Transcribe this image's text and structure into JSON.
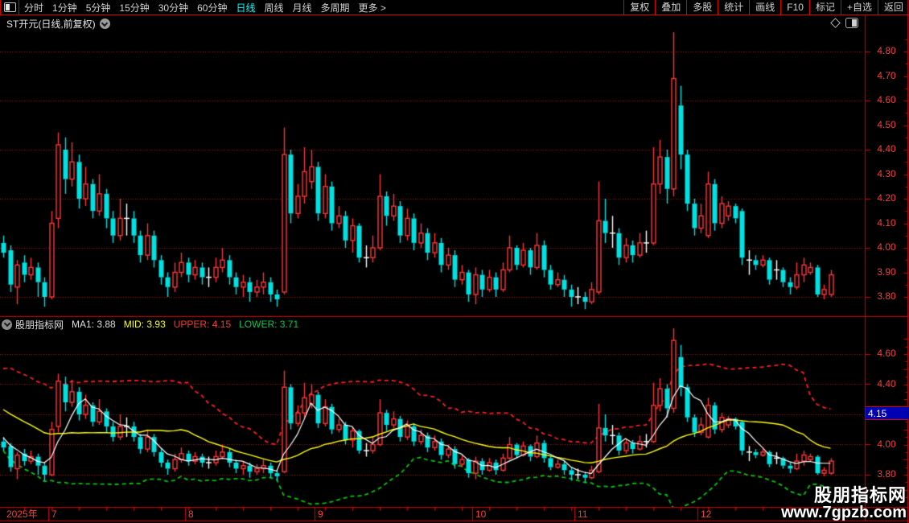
{
  "colors": {
    "background": "#000000",
    "up": "#ff3434",
    "down": "#00e2e2",
    "doji": "#ffffff",
    "grid": "#c80000",
    "border": "#dc0000",
    "axis_text": "#ff3a3a",
    "band_upper": "#ff1e1e",
    "band_lower": "#00c800",
    "mid_line": "#ffff00",
    "ma_line": "#ffffff",
    "highlight_bg": "#0000b4",
    "highlight_text": "#ffffff",
    "menu_text": "#d2d2d2",
    "active_tab": "#00ffff",
    "label_white": "#dcdcdc",
    "label_yellow": "#ffff00",
    "label_red": "#ff3434",
    "label_green": "#00c850",
    "watermark": "#ffffff",
    "date_text": "#ff3a3a"
  },
  "menu": {
    "left_items": [
      {
        "label": "分时"
      },
      {
        "label": "1分钟"
      },
      {
        "label": "5分钟"
      },
      {
        "label": "15分钟"
      },
      {
        "label": "30分钟"
      },
      {
        "label": "60分钟"
      },
      {
        "label": "日线",
        "active": true
      },
      {
        "label": "周线"
      },
      {
        "label": "月线"
      },
      {
        "label": "多周期"
      },
      {
        "label": "更多 >"
      }
    ],
    "right_items": [
      {
        "label": "复权"
      },
      {
        "label": "叠加"
      },
      {
        "label": "多股"
      },
      {
        "label": "统计"
      },
      {
        "label": "画线"
      },
      {
        "label": "F10"
      },
      {
        "label": "标记"
      },
      {
        "label": "+自选"
      },
      {
        "label": "返回"
      }
    ]
  },
  "title": {
    "text": "ST开元(日线,前复权)"
  },
  "indicator": {
    "name": "股朋指标网",
    "ma1": "MA1: 3.88",
    "mid": "MID: 3.93",
    "upper": "UPPER: 4.15",
    "lower": "LOWER: 3.71"
  },
  "axis_top": {
    "labels": [
      {
        "text": "4.80",
        "price": 4.8
      },
      {
        "text": "4.70",
        "price": 4.7
      },
      {
        "text": "4.60",
        "price": 4.6
      },
      {
        "text": "4.50",
        "price": 4.5
      },
      {
        "text": "4.40",
        "price": 4.4
      },
      {
        "text": "4.30",
        "price": 4.3
      },
      {
        "text": "4.20",
        "price": 4.2
      },
      {
        "text": "4.10",
        "price": 4.1
      },
      {
        "text": "4.00",
        "price": 4.0
      },
      {
        "text": "3.90",
        "price": 3.9
      },
      {
        "text": "3.80",
        "price": 3.8
      }
    ]
  },
  "axis_bottom": {
    "labels": [
      {
        "text": "4.60",
        "price": 4.6
      },
      {
        "text": "4.40",
        "price": 4.4
      },
      {
        "text": "4.00",
        "price": 4.0
      },
      {
        "text": "3.80",
        "price": 3.8
      }
    ],
    "highlight": {
      "text": "4.15"
    }
  },
  "date_axis": {
    "year": "2025年",
    "months": [
      {
        "label": "7"
      },
      {
        "label": "8"
      },
      {
        "label": "9"
      },
      {
        "label": "10"
      },
      {
        "label": "11"
      },
      {
        "label": "12"
      }
    ]
  },
  "watermark": {
    "line1": "股朋指标网",
    "line2": "www.7gpzb.com"
  },
  "chart_data": {
    "type": "candlestick",
    "symbol": "ST开元",
    "period": "日线",
    "adjust": "前复权",
    "ohlc_format": [
      "open",
      "high",
      "low",
      "close"
    ],
    "candles": [
      [
        4.02,
        4.05,
        3.96,
        3.98
      ],
      [
        3.99,
        4.01,
        3.82,
        3.85
      ],
      [
        3.84,
        3.95,
        3.77,
        3.93
      ],
      [
        3.94,
        3.97,
        3.86,
        3.89
      ],
      [
        3.89,
        3.96,
        3.87,
        3.92
      ],
      [
        3.92,
        3.94,
        3.8,
        3.86
      ],
      [
        3.86,
        3.88,
        3.76,
        3.8
      ],
      [
        3.8,
        4.15,
        3.79,
        4.1
      ],
      [
        4.12,
        4.47,
        4.08,
        4.42
      ],
      [
        4.4,
        4.45,
        4.22,
        4.28
      ],
      [
        4.28,
        4.43,
        4.25,
        4.35
      ],
      [
        4.35,
        4.38,
        4.16,
        4.2
      ],
      [
        4.2,
        4.33,
        4.17,
        4.26
      ],
      [
        4.26,
        4.28,
        4.12,
        4.15
      ],
      [
        4.15,
        4.3,
        4.13,
        4.22
      ],
      [
        4.22,
        4.24,
        4.08,
        4.12
      ],
      [
        4.12,
        4.15,
        4.02,
        4.05
      ],
      [
        4.05,
        4.2,
        4.03,
        4.12
      ],
      [
        4.12,
        4.18,
        4.05,
        4.12
      ],
      [
        4.12,
        4.15,
        4.02,
        4.05
      ],
      [
        4.05,
        4.07,
        3.94,
        3.97
      ],
      [
        3.97,
        4.1,
        3.95,
        4.05
      ],
      [
        4.05,
        4.07,
        3.92,
        3.95
      ],
      [
        3.95,
        3.97,
        3.85,
        3.88
      ],
      [
        3.88,
        3.9,
        3.8,
        3.84
      ],
      [
        3.84,
        3.94,
        3.82,
        3.9
      ],
      [
        3.9,
        3.98,
        3.88,
        3.94
      ],
      [
        3.94,
        3.96,
        3.86,
        3.89
      ],
      [
        3.89,
        3.95,
        3.87,
        3.92
      ],
      [
        3.92,
        3.94,
        3.85,
        3.88
      ],
      [
        3.88,
        3.92,
        3.84,
        3.88
      ],
      [
        3.88,
        3.96,
        3.86,
        3.92
      ],
      [
        3.92,
        4.0,
        3.9,
        3.95
      ],
      [
        3.95,
        3.97,
        3.85,
        3.88
      ],
      [
        3.88,
        3.9,
        3.81,
        3.84
      ],
      [
        3.84,
        3.89,
        3.8,
        3.86
      ],
      [
        3.86,
        3.88,
        3.78,
        3.82
      ],
      [
        3.82,
        3.87,
        3.8,
        3.84
      ],
      [
        3.84,
        3.9,
        3.81,
        3.86
      ],
      [
        3.86,
        3.88,
        3.78,
        3.81
      ],
      [
        3.81,
        3.83,
        3.76,
        3.79
      ],
      [
        3.82,
        4.49,
        3.81,
        4.38
      ],
      [
        4.38,
        4.4,
        4.1,
        4.14
      ],
      [
        4.14,
        4.26,
        4.12,
        4.21
      ],
      [
        4.21,
        4.41,
        4.18,
        4.31
      ],
      [
        4.27,
        4.4,
        4.24,
        4.33
      ],
      [
        4.33,
        4.35,
        4.11,
        4.14
      ],
      [
        4.14,
        4.3,
        4.12,
        4.25
      ],
      [
        4.25,
        4.27,
        4.07,
        4.1
      ],
      [
        4.1,
        4.17,
        4.08,
        4.13
      ],
      [
        4.13,
        4.15,
        4.0,
        4.03
      ],
      [
        4.03,
        4.12,
        3.98,
        4.09
      ],
      [
        4.09,
        4.1,
        3.94,
        3.96
      ],
      [
        3.96,
        4.01,
        3.92,
        3.96
      ],
      [
        3.96,
        4.05,
        3.94,
        4.0
      ],
      [
        4.0,
        4.3,
        3.99,
        4.21
      ],
      [
        4.21,
        4.23,
        4.09,
        4.13
      ],
      [
        4.13,
        4.22,
        4.11,
        4.17
      ],
      [
        4.17,
        4.19,
        4.02,
        4.05
      ],
      [
        4.05,
        4.16,
        4.03,
        4.12
      ],
      [
        4.12,
        4.14,
        3.99,
        4.02
      ],
      [
        4.02,
        4.1,
        4.0,
        4.06
      ],
      [
        4.06,
        4.08,
        3.95,
        3.98
      ],
      [
        3.98,
        4.06,
        3.96,
        4.02
      ],
      [
        4.02,
        4.04,
        3.9,
        3.93
      ],
      [
        3.93,
        4.0,
        3.91,
        3.97
      ],
      [
        3.97,
        3.99,
        3.84,
        3.87
      ],
      [
        3.87,
        3.93,
        3.85,
        3.9
      ],
      [
        3.9,
        3.91,
        3.78,
        3.81
      ],
      [
        3.81,
        3.92,
        3.77,
        3.89
      ],
      [
        3.89,
        3.91,
        3.8,
        3.83
      ],
      [
        3.83,
        3.91,
        3.82,
        3.88
      ],
      [
        3.88,
        3.9,
        3.8,
        3.83
      ],
      [
        3.83,
        3.94,
        3.82,
        3.91
      ],
      [
        3.91,
        4.05,
        3.9,
        4.0
      ],
      [
        4.0,
        4.01,
        3.91,
        3.93
      ],
      [
        3.93,
        4.02,
        3.92,
        3.99
      ],
      [
        3.99,
        4.0,
        3.89,
        3.92
      ],
      [
        3.92,
        4.06,
        3.91,
        4.01
      ],
      [
        4.01,
        4.03,
        3.88,
        3.91
      ],
      [
        3.91,
        3.93,
        3.83,
        3.85
      ],
      [
        3.85,
        3.9,
        3.84,
        3.87
      ],
      [
        3.87,
        3.89,
        3.8,
        3.83
      ],
      [
        3.83,
        3.85,
        3.76,
        3.8
      ],
      [
        3.8,
        3.84,
        3.77,
        3.8
      ],
      [
        3.8,
        3.82,
        3.75,
        3.78
      ],
      [
        3.78,
        3.86,
        3.77,
        3.83
      ],
      [
        3.82,
        4.27,
        3.81,
        4.11
      ],
      [
        4.11,
        4.2,
        4.02,
        4.06
      ],
      [
        4.06,
        4.13,
        4.0,
        4.06
      ],
      [
        4.06,
        4.08,
        3.93,
        3.96
      ],
      [
        3.96,
        4.04,
        3.94,
        4.01
      ],
      [
        4.01,
        4.03,
        3.94,
        3.97
      ],
      [
        3.97,
        4.06,
        3.96,
        4.02
      ],
      [
        4.02,
        4.07,
        3.98,
        4.02
      ],
      [
        4.02,
        4.41,
        4.01,
        4.26
      ],
      [
        4.26,
        4.44,
        4.22,
        4.37
      ],
      [
        4.37,
        4.4,
        4.18,
        4.24
      ],
      [
        4.24,
        4.88,
        4.21,
        4.69
      ],
      [
        4.58,
        4.66,
        4.32,
        4.38
      ],
      [
        4.38,
        4.4,
        4.15,
        4.18
      ],
      [
        4.18,
        4.2,
        4.05,
        4.08
      ],
      [
        4.08,
        4.18,
        4.06,
        4.13
      ],
      [
        4.05,
        4.31,
        4.04,
        4.26
      ],
      [
        4.26,
        4.28,
        4.07,
        4.1
      ],
      [
        4.1,
        4.21,
        4.08,
        4.18
      ],
      [
        4.13,
        4.19,
        4.11,
        4.17
      ],
      [
        4.17,
        4.18,
        4.1,
        4.12
      ],
      [
        4.15,
        4.16,
        3.93,
        3.96
      ],
      [
        3.95,
        3.99,
        3.89,
        3.95
      ],
      [
        3.95,
        3.97,
        3.91,
        3.93
      ],
      [
        3.93,
        3.97,
        3.92,
        3.95
      ],
      [
        3.95,
        3.96,
        3.85,
        3.87
      ],
      [
        3.91,
        3.95,
        3.87,
        3.91
      ],
      [
        3.91,
        3.92,
        3.84,
        3.86
      ],
      [
        3.86,
        3.88,
        3.81,
        3.84
      ],
      [
        3.84,
        3.94,
        3.83,
        3.89
      ],
      [
        3.89,
        3.96,
        3.86,
        3.93
      ],
      [
        3.9,
        3.94,
        3.89,
        3.92
      ],
      [
        3.92,
        3.93,
        3.8,
        3.81
      ],
      [
        3.81,
        3.85,
        3.79,
        3.83
      ],
      [
        3.81,
        3.91,
        3.8,
        3.89
      ]
    ],
    "pre_window_closes": [
      4.45,
      4.42,
      4.44,
      4.4,
      4.36,
      4.38,
      4.32,
      4.3,
      4.33,
      4.27,
      4.24,
      4.26,
      4.2,
      4.17,
      4.19,
      4.13,
      4.1,
      4.08,
      4.05,
      4.02
    ],
    "months_start_bar": [
      7,
      27,
      46,
      69,
      84,
      102
    ],
    "month_labels": [
      "7",
      "8",
      "9",
      "10",
      "11",
      "12"
    ],
    "top_panel": {
      "grid_prices": [
        4.8,
        4.6,
        4.4,
        4.2,
        4.0,
        3.8
      ],
      "axis_tick_prices": [
        4.8,
        4.7,
        4.6,
        4.5,
        4.4,
        4.3,
        4.2,
        4.1,
        4.0,
        3.9,
        3.8
      ],
      "ylim": [
        3.72,
        4.88
      ]
    },
    "indicator_panel": {
      "name": "股朋指标网",
      "indicator_type": "bollinger",
      "period": 20,
      "stdev_mult": 2,
      "ma_period": 5,
      "grid_prices": [
        4.6,
        4.4,
        4.2,
        4.0,
        3.8
      ],
      "last_values": {
        "MA1": 3.88,
        "MID": 3.93,
        "UPPER": 4.15,
        "LOWER": 3.71
      },
      "highlight_value": 4.15
    }
  }
}
